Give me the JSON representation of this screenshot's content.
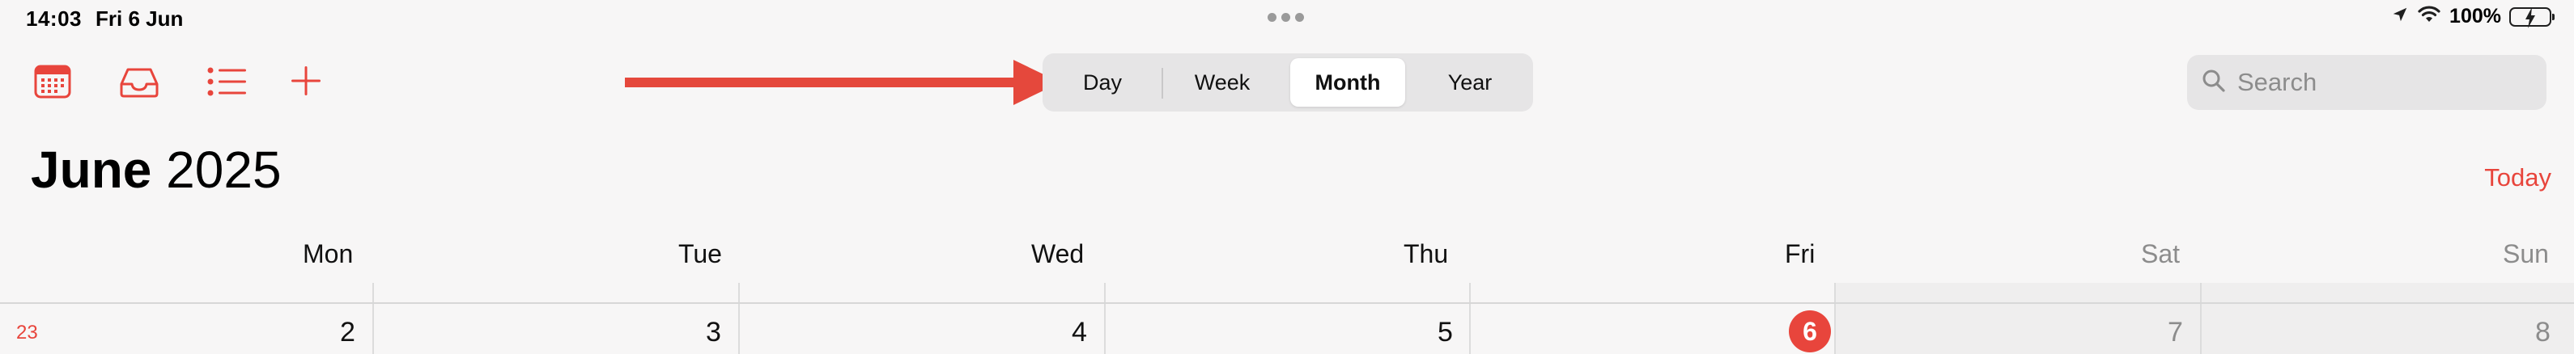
{
  "status_bar": {
    "time": "14:03",
    "date": "Fri 6 Jun",
    "battery": "100%"
  },
  "toolbar": {
    "icons": [
      "calendar-icon",
      "inbox-icon",
      "list-icon",
      "add-icon"
    ],
    "accent_color": "#e8453c"
  },
  "view_switcher": {
    "segments": [
      "Day",
      "Week",
      "Month",
      "Year"
    ],
    "selected": "Month"
  },
  "search": {
    "placeholder": "Search"
  },
  "title": {
    "month": "June",
    "year": "2025"
  },
  "today_label": "Today",
  "weekdays": [
    "Mon",
    "Tue",
    "Wed",
    "Thu",
    "Fri",
    "Sat",
    "Sun"
  ],
  "week": {
    "number": "23",
    "days": [
      "2",
      "3",
      "4",
      "5",
      "6",
      "7",
      "8"
    ],
    "today": "6"
  },
  "annotation": {
    "arrow_color": "#e5483c"
  }
}
